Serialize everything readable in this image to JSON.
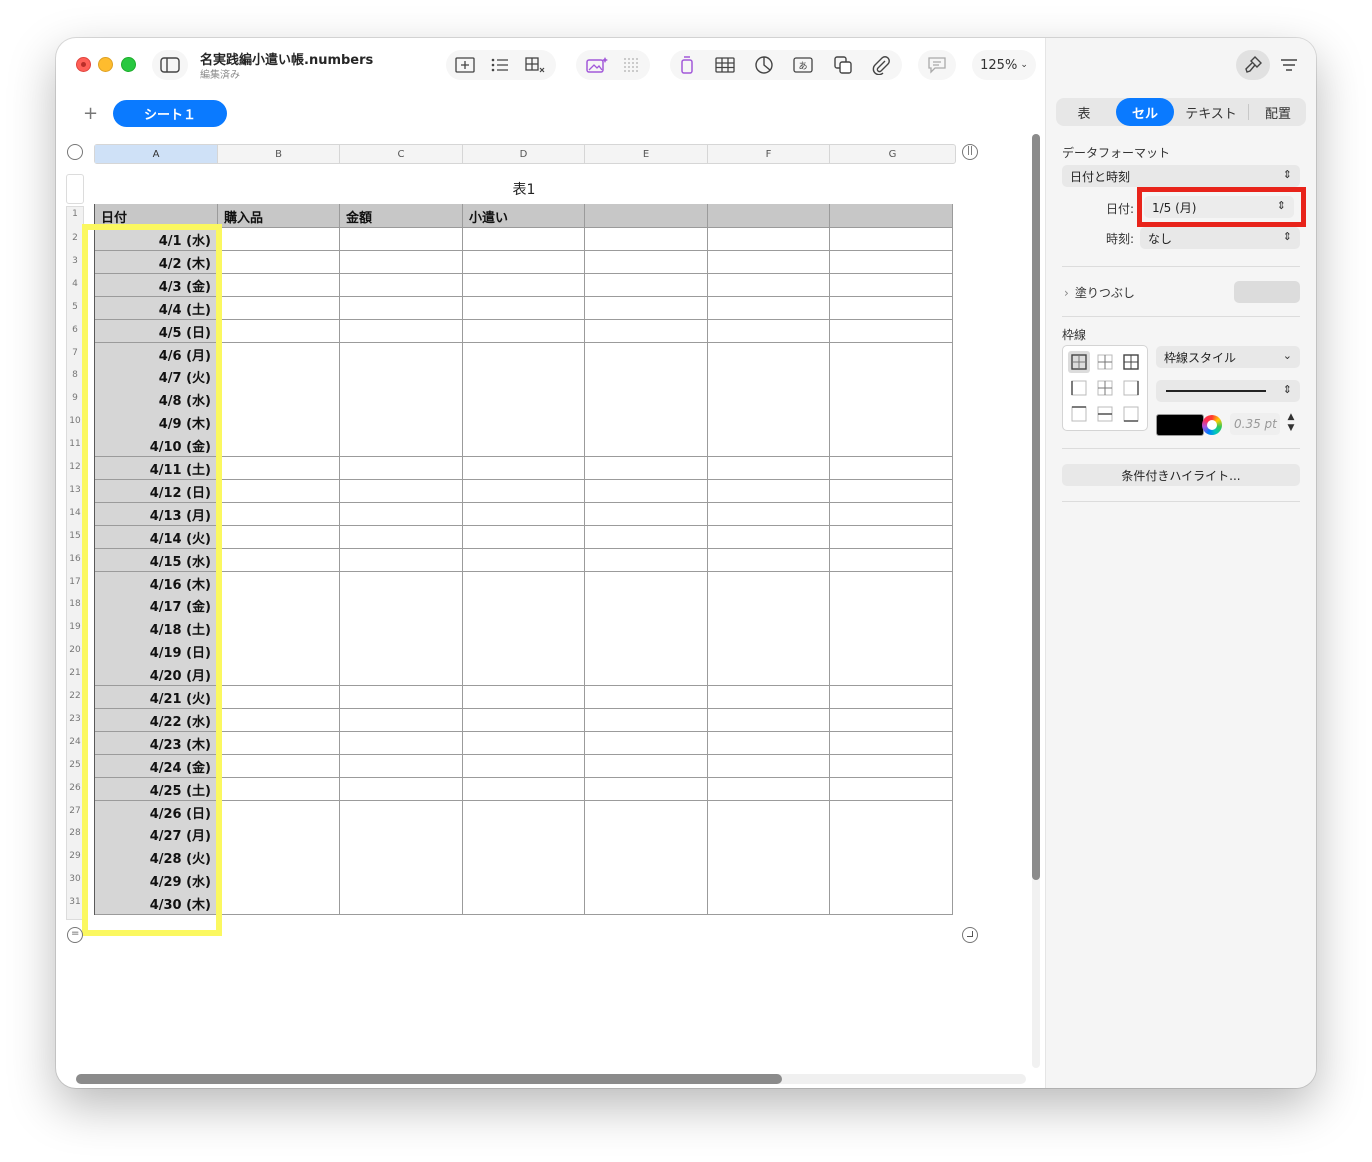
{
  "window": {
    "title": "名実践編小遣い帳.numbers",
    "subtitle": "編集済み",
    "zoom": "125%"
  },
  "sheet": {
    "add_label": "+",
    "tab_label": "シート１"
  },
  "table": {
    "title": "表1",
    "columns": [
      "A",
      "B",
      "C",
      "D",
      "E",
      "F",
      "G"
    ],
    "headers": [
      "日付",
      "購入品",
      "金額",
      "小遣い",
      "",
      "",
      ""
    ],
    "row_numbers": [
      "1",
      "2",
      "3",
      "4",
      "5",
      "6",
      "7",
      "8",
      "9",
      "10",
      "11",
      "12",
      "13",
      "14",
      "15",
      "16",
      "17",
      "18",
      "19",
      "20",
      "21",
      "22",
      "23",
      "24",
      "25",
      "26",
      "27",
      "28",
      "29",
      "30",
      "31"
    ],
    "dates": [
      "4/1 (水)",
      "4/2 (木)",
      "4/3 (金)",
      "4/4 (土)",
      "4/5 (日)",
      "4/6 (月)",
      "4/7 (火)",
      "4/8 (水)",
      "4/9 (木)",
      "4/10 (金)",
      "4/11 (土)",
      "4/12 (日)",
      "4/13 (月)",
      "4/14 (火)",
      "4/15 (水)",
      "4/16 (木)",
      "4/17 (金)",
      "4/18 (土)",
      "4/19 (日)",
      "4/20 (月)",
      "4/21 (火)",
      "4/22 (水)",
      "4/23 (木)",
      "4/24 (金)",
      "4/25 (土)",
      "4/26 (日)",
      "4/27 (月)",
      "4/28 (火)",
      "4/29 (水)",
      "4/30 (木)"
    ]
  },
  "inspector": {
    "tabs": [
      "表",
      "セル",
      "テキスト",
      "配置"
    ],
    "active_tab": "セル",
    "data_format_label": "データフォーマット",
    "data_format_value": "日付と時刻",
    "date_label": "日付:",
    "date_value": "1/5 (月)",
    "time_label": "時刻:",
    "time_value": "なし",
    "fill_label": "塗りつぶし",
    "border_label": "枠線",
    "border_style_label": "枠線スタイル",
    "border_width": "0.35 pt",
    "conditional_highlight_label": "条件付きハイライト..."
  },
  "colors": {
    "accent": "#0a7aff",
    "highlight_yellow": "#fbf860",
    "highlight_red": "#e8231a"
  }
}
